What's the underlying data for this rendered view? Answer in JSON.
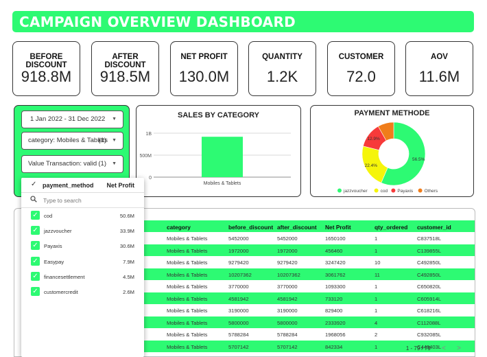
{
  "title": "CAMPAIGN OVERVIEW DASHBOARD",
  "colors": {
    "accent": "#2dfa73",
    "yellow": "#f5f50a",
    "red": "#f73a3a",
    "orange": "#f07d1a",
    "bar": "#2dfa73"
  },
  "kpis": [
    {
      "label": "BEFORE DISCOUNT",
      "value": "918.8M"
    },
    {
      "label": "AFTER DISCOUNT",
      "value": "918.5M"
    },
    {
      "label": "NET PROFIT",
      "value": "130.0M"
    },
    {
      "label": "QUANTITY",
      "value": "1.2K"
    },
    {
      "label": "CUSTOMER",
      "value": "72.0"
    },
    {
      "label": "AOV",
      "value": "11.6M"
    }
  ],
  "filters": {
    "date_range": "1 Jan 2022 - 31 Dec 2022",
    "category_label": "category: Mobiles & Tablets",
    "category_count": "(1)",
    "value_label": "Value Transaction: valid",
    "value_count": "(1)"
  },
  "sales_chart": {
    "title": "SALES BY CATEGORY",
    "chart_data": {
      "type": "bar",
      "categories": [
        "Mobiles & Tablets"
      ],
      "values": [
        918800000
      ],
      "y_ticks": [
        "1B",
        "500M",
        "0"
      ],
      "ylim": [
        0,
        1000000000
      ],
      "grid": true
    }
  },
  "payment_chart": {
    "title": "PAYMENT METHODE",
    "chart_data": {
      "type": "pie",
      "donut": true,
      "slices": [
        {
          "label": "jazzvoucher",
          "value": 56.5,
          "color": "#2dfa73",
          "pct_label": "56.5%"
        },
        {
          "label": "cod",
          "value": 22.4,
          "color": "#f5f50a",
          "pct_label": "22.4%"
        },
        {
          "label": "Payaxis",
          "value": 12.9,
          "color": "#f73a3a",
          "pct_label": "12.9%"
        },
        {
          "label": "Others",
          "value": 8.2,
          "color": "#f07d1a",
          "pct_label": ""
        }
      ],
      "legend": "bottom"
    }
  },
  "table": {
    "headers": [
      "category",
      "before_discount",
      "after_discount",
      "Net Profit",
      "qty_ordered",
      "customer_id"
    ],
    "rows": [
      [
        "Mobiles & Tablets",
        "5452000",
        "5452000",
        "1650100",
        "1",
        "C837518L"
      ],
      [
        "Mobiles & Tablets",
        "1972000",
        "1972000",
        "456460",
        "1",
        "C139855L"
      ],
      [
        "Mobiles & Tablets",
        "9279420",
        "9279420",
        "3247420",
        "10",
        "C492850L"
      ],
      [
        "Mobiles & Tablets",
        "10207362",
        "10207362",
        "3061762",
        "11",
        "C492850L"
      ],
      [
        "Mobiles & Tablets",
        "3770000",
        "3770000",
        "1093300",
        "1",
        "C650820L"
      ],
      [
        "Mobiles & Tablets",
        "4581942",
        "4581942",
        "733120",
        "1",
        "C605914L"
      ],
      [
        "Mobiles & Tablets",
        "3190000",
        "3190000",
        "829400",
        "1",
        "C618216L"
      ],
      [
        "Mobiles & Tablets",
        "5800000",
        "5800000",
        "2333920",
        "4",
        "C112088L"
      ],
      [
        "Mobiles & Tablets",
        "5788284",
        "5788284",
        "1968056",
        "2",
        "C932085L"
      ],
      [
        "Mobiles & Tablets",
        "5707142",
        "5707142",
        "842334",
        "1",
        "C449403L"
      ]
    ],
    "pager": "1 - 79 / 79",
    "prev": "<",
    "next": ">"
  },
  "dropdown": {
    "header_field": "payment_method",
    "header_metric": "Net Profit",
    "search_placeholder": "Type to search",
    "items": [
      {
        "name": "cod",
        "value": "50.6M"
      },
      {
        "name": "jazzvoucher",
        "value": "33.9M"
      },
      {
        "name": "Payaxis",
        "value": "30.6M"
      },
      {
        "name": "Easypay",
        "value": "7.9M"
      },
      {
        "name": "financesettlement",
        "value": "4.5M"
      },
      {
        "name": "customercredit",
        "value": "2.6M"
      }
    ]
  }
}
